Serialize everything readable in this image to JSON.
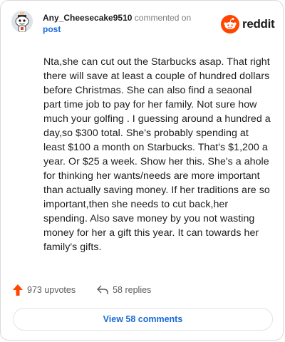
{
  "header": {
    "username": "Any_Cheesecake9510",
    "action_text": "commented on",
    "target_link": "post",
    "brand": "reddit"
  },
  "comment": {
    "text": "Nta,she can cut out the Starbucks asap. That right there will save at least a couple of hundred dollars before Christmas. She can also find a seaonal part time job to pay for her family. Not sure how much your golfing . I guessing around a hundred a day,so $300 total. She's probably spending at least $100 a month on Starbucks. That's $1,200 a year. Or $25 a week. Show her this. She's a ahole for thinking her wants/needs are more important than actually saving money. If her traditions are so important,then she needs to cut back,her spending. Also save money by you not wasting money for her a gift this year. It can towards her family's gifts."
  },
  "stats": {
    "upvotes": "973 upvotes",
    "replies": "58 replies"
  },
  "footer": {
    "view_comments_label": "View 58 comments"
  },
  "colors": {
    "reddit_orange": "#ff4500",
    "link_blue": "#1a6ad6",
    "text": "#1c1c1c",
    "muted": "#7c7c7c"
  },
  "icons": {
    "avatar": "snoo-avatar-icon",
    "logo": "reddit-snoo-icon",
    "upvote": "upvote-arrow-icon",
    "reply": "reply-arrow-icon"
  }
}
